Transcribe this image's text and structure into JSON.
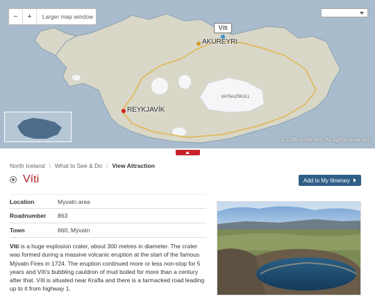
{
  "map": {
    "zoom_out": "−",
    "zoom_in": "+",
    "larger_map": "Larger map window",
    "select_value": "",
    "callout": "Víti",
    "labels": {
      "akureyri": "AKUREYRI",
      "reykjavik": "REYKJAVÍK",
      "vatnajokull": "VATNAJÖKULL"
    },
    "copyright": "© Loftmyndir ehf. All rights reserved",
    "colors": {
      "sea": "#a9bccd",
      "land": "#d8d7c8",
      "glacier": "#ffffff",
      "road": "#e2b54c",
      "pin_red": "#cc2222",
      "pin_gold": "#d99e1c"
    }
  },
  "breadcrumb": [
    "North Iceland",
    "What to See & Do",
    "View Attraction"
  ],
  "page": {
    "title": "Víti",
    "add_button": "Add to My Itinerary"
  },
  "info": [
    {
      "key": "Location",
      "value": "Myvatn area"
    },
    {
      "key": "Roadnumber",
      "value": "863"
    },
    {
      "key": "Town",
      "value": "660, Mývatn"
    }
  ],
  "description": {
    "bold_word": "Víti",
    "text": " is a huge explosion crater, about 300 metres in diameter. The crater was formed during a massive volcanic eruption at the start of the famous Mývatn Fires in 1724. The eruption continued more or less non-stop for 5 years and Víti's bubbling cauldron of mud boiled for more than a century after that. Víti is situated near Krafla and there is a tarmacked road leading up to it from highway 1."
  }
}
